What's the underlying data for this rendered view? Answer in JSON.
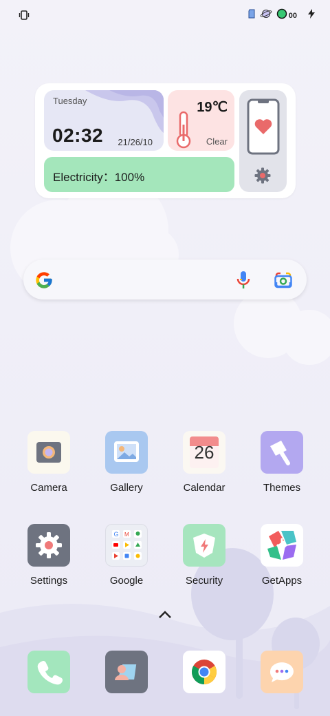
{
  "status_bar": {
    "left_icon": "vibrate-icon",
    "right_icons": [
      "sim-icon",
      "planet-icon",
      "circle-icon"
    ],
    "badge_text": "00",
    "charging_icon": "bolt-icon"
  },
  "widget": {
    "day": "Tuesday",
    "time": "02:32",
    "date": "21/26/10",
    "temperature": "19℃",
    "condition": "Clear",
    "battery_label": "Electricity：100%",
    "phone_icon": "phone-heart-icon",
    "settings_icon": "gear-icon"
  },
  "search": {
    "google_icon": "google-g-icon",
    "mic_icon": "mic-icon",
    "lens_icon": "lens-icon"
  },
  "apps_row1": [
    {
      "label": "Camera",
      "icon": "camera-icon"
    },
    {
      "label": "Gallery",
      "icon": "gallery-icon"
    },
    {
      "label": "Calendar",
      "icon": "calendar-icon",
      "day_number": "26"
    },
    {
      "label": "Themes",
      "icon": "themes-icon"
    }
  ],
  "apps_row2": [
    {
      "label": "Settings",
      "icon": "settings-icon"
    },
    {
      "label": "Google",
      "icon": "google-folder-icon"
    },
    {
      "label": "Security",
      "icon": "security-icon"
    },
    {
      "label": "GetApps",
      "icon": "getapps-icon"
    }
  ],
  "drawer_icon": "chevron-up-icon",
  "dock": [
    {
      "name": "phone",
      "icon": "phone-icon"
    },
    {
      "name": "contacts",
      "icon": "contacts-icon"
    },
    {
      "name": "chrome",
      "icon": "chrome-icon"
    },
    {
      "name": "messages",
      "icon": "messages-icon"
    }
  ],
  "colors": {
    "background": "#f1f0f8",
    "battery_green": "#a4e6bb",
    "weather_pink": "#fde3e3",
    "clock_lavender": "#e6e7f5",
    "themes_purple": "#b3a8f0",
    "security_green": "#a6e5be",
    "settings_gray": "#6e7380"
  }
}
